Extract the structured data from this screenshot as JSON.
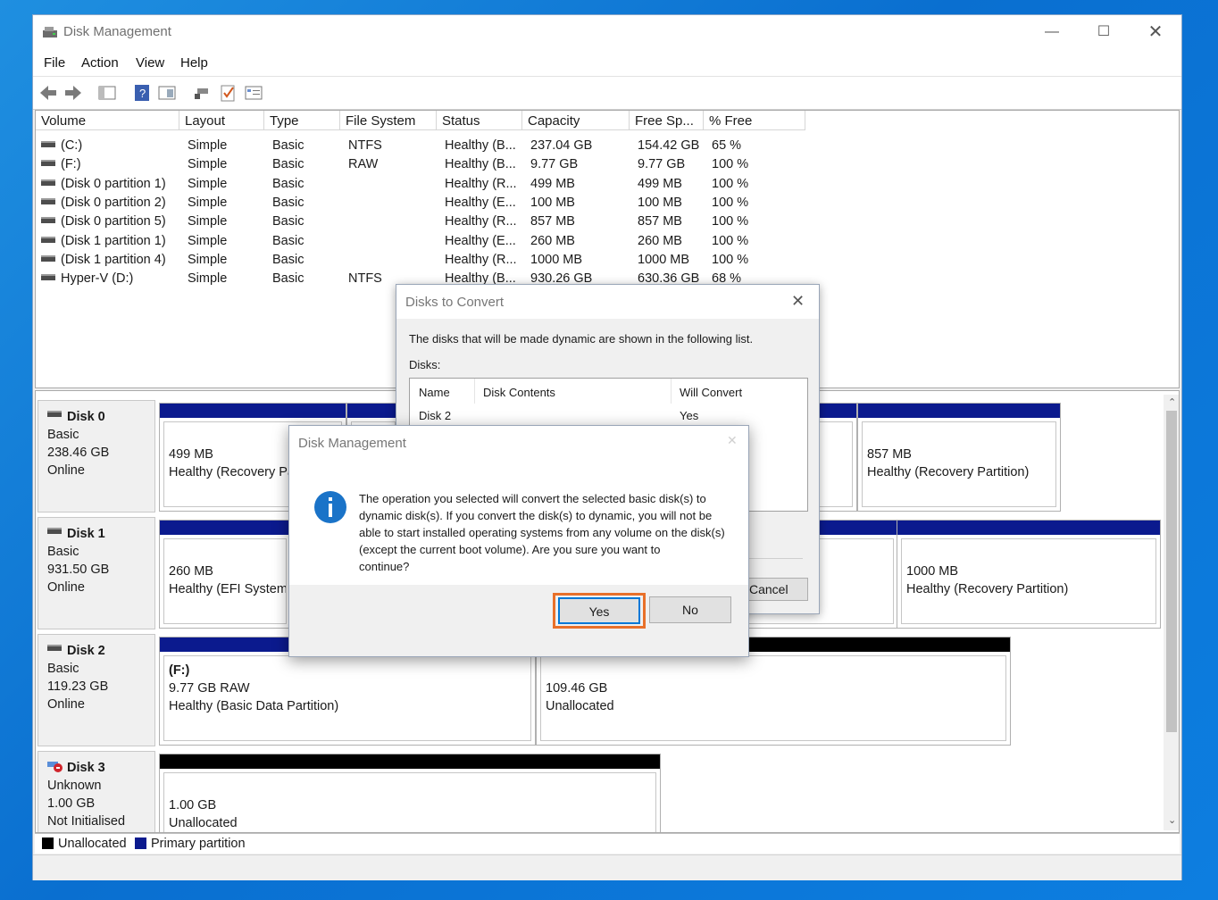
{
  "window": {
    "title": "Disk Management"
  },
  "menu": [
    "File",
    "Action",
    "View",
    "Help"
  ],
  "toolbar_icons": [
    "back-icon",
    "forward-icon",
    "console-tree-icon",
    "help-icon",
    "properties-icon",
    "connect-icon",
    "check-icon",
    "list-icon"
  ],
  "volume_table": {
    "columns": [
      "Volume",
      "Layout",
      "Type",
      "File System",
      "Status",
      "Capacity",
      "Free Sp...",
      "% Free"
    ],
    "rows": [
      [
        "(C:)",
        "Simple",
        "Basic",
        "NTFS",
        "Healthy (B...",
        "237.04 GB",
        "154.42 GB",
        "65 %"
      ],
      [
        "(F:)",
        "Simple",
        "Basic",
        "RAW",
        "Healthy (B...",
        "9.77 GB",
        "9.77 GB",
        "100 %"
      ],
      [
        "(Disk 0 partition 1)",
        "Simple",
        "Basic",
        "",
        "Healthy (R...",
        "499 MB",
        "499 MB",
        "100 %"
      ],
      [
        "(Disk 0 partition 2)",
        "Simple",
        "Basic",
        "",
        "Healthy (E...",
        "100 MB",
        "100 MB",
        "100 %"
      ],
      [
        "(Disk 0 partition 5)",
        "Simple",
        "Basic",
        "",
        "Healthy (R...",
        "857 MB",
        "857 MB",
        "100 %"
      ],
      [
        "(Disk 1 partition 1)",
        "Simple",
        "Basic",
        "",
        "Healthy (E...",
        "260 MB",
        "260 MB",
        "100 %"
      ],
      [
        "(Disk 1 partition 4)",
        "Simple",
        "Basic",
        "",
        "Healthy (R...",
        "1000 MB",
        "1000 MB",
        "100 %"
      ],
      [
        "Hyper-V (D:)",
        "Simple",
        "Basic",
        "NTFS",
        "Healthy (B...",
        "930.26 GB",
        "630.36 GB",
        "68 %"
      ]
    ]
  },
  "disks": [
    {
      "name": "Disk 0",
      "type": "Basic",
      "size": "238.46 GB",
      "state": "Online",
      "partitions": [
        {
          "l1": "",
          "l2": "499 MB",
          "l3": "Healthy (Recovery Pa"
        },
        {
          "l1": "",
          "l2": "",
          "l3": ""
        },
        {
          "l1": "",
          "l2": "",
          "l3": "on)"
        },
        {
          "l1": "",
          "l2": "857 MB",
          "l3": "Healthy (Recovery Partition)"
        }
      ]
    },
    {
      "name": "Disk 1",
      "type": "Basic",
      "size": "931.50 GB",
      "state": "Online",
      "partitions": [
        {
          "l1": "",
          "l2": "260 MB",
          "l3": "Healthy (EFI System I"
        },
        {
          "l1": "",
          "l2": "",
          "l3": ""
        },
        {
          "l1": "",
          "l2": "1000 MB",
          "l3": "Healthy (Recovery Partition)"
        }
      ]
    },
    {
      "name": "Disk 2",
      "type": "Basic",
      "size": "119.23 GB",
      "state": "Online",
      "partitions": [
        {
          "l1": "(F:)",
          "l2": "9.77 GB RAW",
          "l3": "Healthy (Basic Data Partition)"
        },
        {
          "l1": "",
          "l2": "109.46 GB",
          "l3": "Unallocated"
        }
      ]
    },
    {
      "name": "Disk 3",
      "type": "Unknown",
      "size": "1.00 GB",
      "state": "Not Initialised",
      "partitions": [
        {
          "l1": "",
          "l2": "1.00 GB",
          "l3": "Unallocated"
        }
      ]
    }
  ],
  "legend": {
    "unallocated": "Unallocated",
    "primary": "Primary partition"
  },
  "colors": {
    "primary": "#0b1a8e",
    "unallocated": "#000000",
    "highlight": "#e8702a",
    "info": "#1a73c8"
  },
  "convert_dialog": {
    "title": "Disks to Convert",
    "intro": "The disks that will be made dynamic are shown in the following list.",
    "disks_label": "Disks:",
    "columns": [
      "Name",
      "Disk Contents",
      "Will Convert"
    ],
    "rows": [
      [
        "Disk 2",
        "",
        "Yes"
      ]
    ],
    "cancel_partial": "Cancel"
  },
  "confirm_dialog": {
    "title": "Disk Management",
    "message_lines": [
      "The operation you selected will convert the selected basic disk(s) to",
      "dynamic disk(s). If you convert the disk(s) to dynamic, you will not be",
      "able to start installed operating systems from any volume on the disk(s)",
      "(except the current boot volume). Are you sure you want to",
      "continue?"
    ],
    "yes": "Yes",
    "no": "No"
  }
}
